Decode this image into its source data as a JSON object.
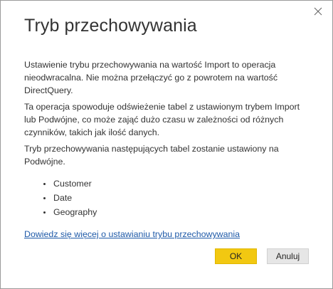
{
  "dialog": {
    "title": "Tryb przechowywania",
    "paragraph1": "Ustawienie trybu przechowywania na wartość Import to operacja nieodwracalna. Nie można przełączyć go z powrotem na wartość DirectQuery.",
    "paragraph2": "Ta operacja spowoduje odświeżenie tabel z ustawionym trybem Import lub Podwójne, co może zająć dużo czasu w zależności od różnych czynników, takich jak ilość danych.",
    "paragraph3": "Tryb przechowywania następujących tabel zostanie ustawiony na Podwójne.",
    "tables": [
      "Customer",
      "Date",
      "Geography"
    ],
    "learn_more_link": "Dowiedz się więcej o ustawianiu trybu przechowywania",
    "ok_label": "OK",
    "cancel_label": "Anuluj"
  },
  "icons": {
    "close": "close-icon"
  },
  "colors": {
    "ok_button": "#f2c811",
    "link": "#1f5aa8",
    "cancel_button": "#e6e6e6"
  }
}
